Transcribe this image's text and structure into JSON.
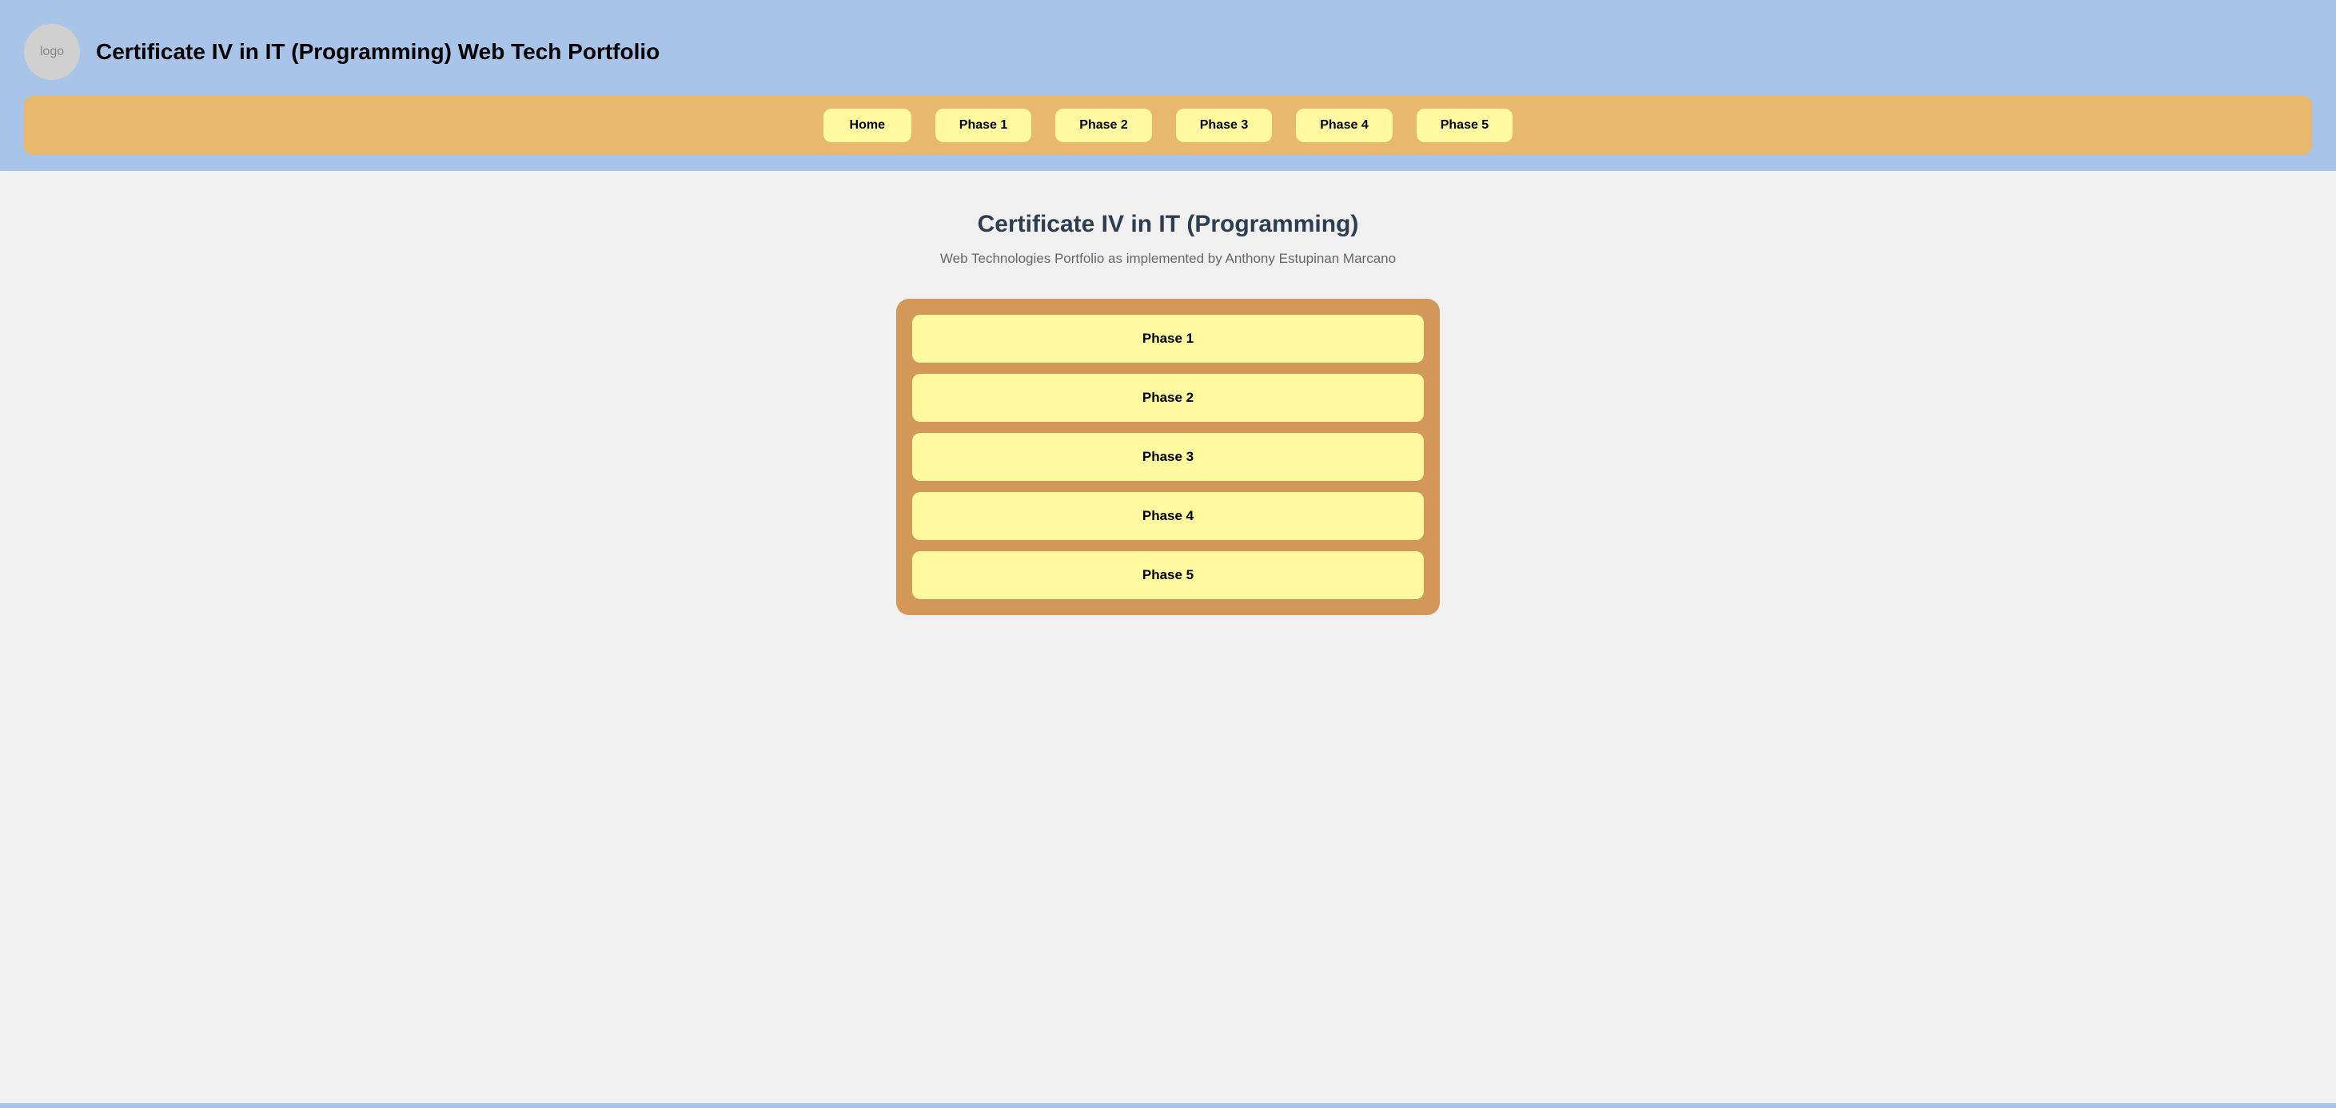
{
  "header": {
    "logo_text": "logo",
    "title": "Certificate IV in IT (Programming) Web Tech Portfolio"
  },
  "nav": {
    "buttons": [
      {
        "id": "home",
        "label": "Home"
      },
      {
        "id": "phase1",
        "label": "Phase 1"
      },
      {
        "id": "phase2",
        "label": "Phase 2"
      },
      {
        "id": "phase3",
        "label": "Phase 3"
      },
      {
        "id": "phase4",
        "label": "Phase 4"
      },
      {
        "id": "phase5",
        "label": "Phase 5"
      }
    ]
  },
  "main": {
    "page_title": "Certificate IV in IT (Programming)",
    "page_subtitle": "Web Technologies Portfolio as implemented by Anthony Estupinan Marcano",
    "phases": [
      {
        "id": "phase1",
        "label": "Phase 1"
      },
      {
        "id": "phase2",
        "label": "Phase 2"
      },
      {
        "id": "phase3",
        "label": "Phase 3"
      },
      {
        "id": "phase4",
        "label": "Phase 4"
      },
      {
        "id": "phase5",
        "label": "Phase 5"
      }
    ]
  },
  "colors": {
    "header_bg": "#a8c4e8",
    "nav_bg": "#e8b86d",
    "button_bg": "#fff9a0",
    "phase_container_bg": "#d4975a",
    "page_title_color": "#2c3e50",
    "subtitle_color": "#666666"
  }
}
